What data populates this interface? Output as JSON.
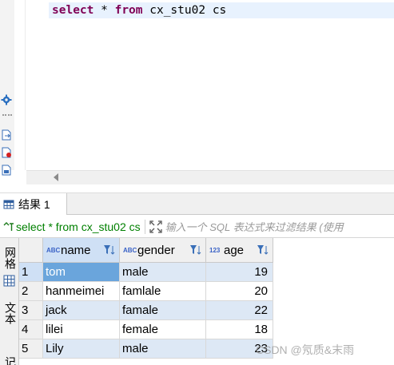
{
  "editor": {
    "sql": [
      {
        "text": "select",
        "kind": "kw"
      },
      {
        "text": " * ",
        "kind": "id"
      },
      {
        "text": "from",
        "kind": "kw"
      },
      {
        "text": " cx_stu02 cs",
        "kind": "id"
      }
    ]
  },
  "results": {
    "tab_label": "结果 1",
    "filter_query": "select * from cx_stu02 cs",
    "filter_placeholder": "输入一个 SQL 表达式来过滤结果 (使用",
    "side_tabs": [
      "网格",
      "文本",
      "记"
    ],
    "columns": [
      {
        "type": "ABC",
        "name": "name"
      },
      {
        "type": "ABC",
        "name": "gender"
      },
      {
        "type": "123",
        "name": "age"
      }
    ],
    "rows": [
      {
        "n": "1",
        "name": "tom",
        "gender": "male",
        "age": "19"
      },
      {
        "n": "2",
        "name": "hanmeimei",
        "gender": "famlale",
        "age": "20"
      },
      {
        "n": "3",
        "name": "jack",
        "gender": "famale",
        "age": "22"
      },
      {
        "n": "4",
        "name": "lilei",
        "gender": "female",
        "age": "18"
      },
      {
        "n": "5",
        "name": "Lily",
        "gender": "male",
        "age": "23"
      }
    ]
  },
  "watermark": "CSDN @氖质&末雨",
  "colors": {
    "keyword": "#7f0055",
    "filter_text": "#008000",
    "selection": "#6aa5dc"
  }
}
